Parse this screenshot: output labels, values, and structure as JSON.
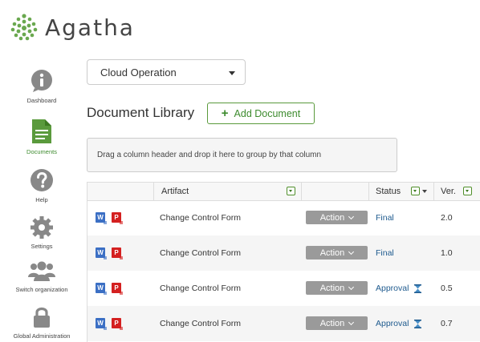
{
  "app": {
    "logo_text": "Agatha",
    "brand_color": "#5a9a3c",
    "link_color": "#1e5a8e"
  },
  "sidebar": {
    "items": [
      {
        "label": "Dashboard",
        "icon": "info-icon",
        "active": false
      },
      {
        "label": "Documents",
        "icon": "document-icon",
        "active": true
      },
      {
        "label": "Help",
        "icon": "question-icon",
        "active": false
      },
      {
        "label": "Settings",
        "icon": "gear-icon",
        "active": false
      },
      {
        "label": "Switch organization",
        "icon": "users-icon",
        "active": false
      },
      {
        "label": "Global Administration",
        "icon": "lock-icon",
        "active": false
      }
    ]
  },
  "org_select": {
    "value": "Cloud Operation"
  },
  "page": {
    "title": "Document Library",
    "add_button": "Add Document"
  },
  "grid": {
    "group_hint": "Drag a column header and drop it here to group by that column",
    "columns": [
      "Artifact",
      "Status",
      "Ver."
    ],
    "action_label": "Action",
    "rows": [
      {
        "artifact": "Change Control Form",
        "status": "Final",
        "pending": false,
        "version": "2.0"
      },
      {
        "artifact": "Change Control Form",
        "status": "Final",
        "pending": false,
        "version": "1.0"
      },
      {
        "artifact": "Change Control Form",
        "status": "Approval",
        "pending": true,
        "version": "0.5"
      },
      {
        "artifact": "Change Control Form",
        "status": "Approval",
        "pending": true,
        "version": "0.7"
      }
    ],
    "file_badges": [
      "W",
      "P"
    ]
  }
}
